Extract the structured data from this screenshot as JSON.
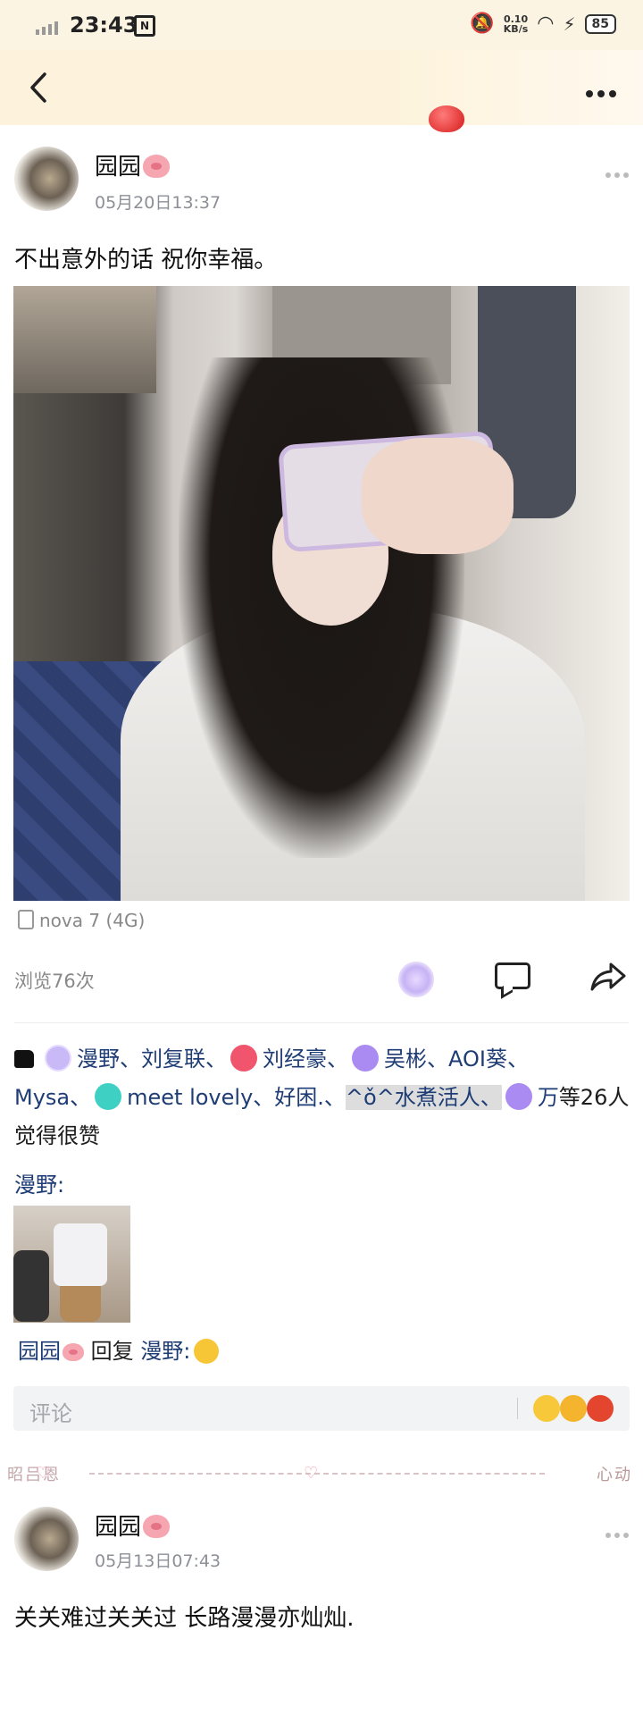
{
  "status_bar": {
    "time": "23:43",
    "net_speed_value": "0.10",
    "net_speed_unit": "KB/s",
    "battery": "85"
  },
  "nav": {
    "back_icon": "chevron-left-icon",
    "more_icon": "more-horizontal-icon"
  },
  "posts": [
    {
      "author": "园园",
      "date": "05月20日13:37",
      "text": "不出意外的话 祝你幸福。",
      "device": "nova 7 (4G)",
      "views": "浏览76次",
      "likes": {
        "names": [
          "漫野、",
          "刘复联、",
          "刘经豪、",
          "吴彬、",
          "AOI葵、",
          "Mysa、",
          "meet lovely、",
          "好困.、",
          "^ǒ^水煮活人、",
          "万"
        ],
        "suffix": "等26人觉得很赞"
      },
      "comments": [
        {
          "author": "漫野:",
          "has_image": true
        },
        {
          "author": "园园",
          "reply_word": "回复",
          "target": "漫野:"
        }
      ],
      "comment_placeholder": "评论"
    },
    {
      "author": "园园",
      "date": "05月13日07:43",
      "text": "关关难过关关过 长路漫漫亦灿灿."
    }
  ],
  "decoration": {
    "left_text": "昭吕恩",
    "right_text": "心动"
  }
}
